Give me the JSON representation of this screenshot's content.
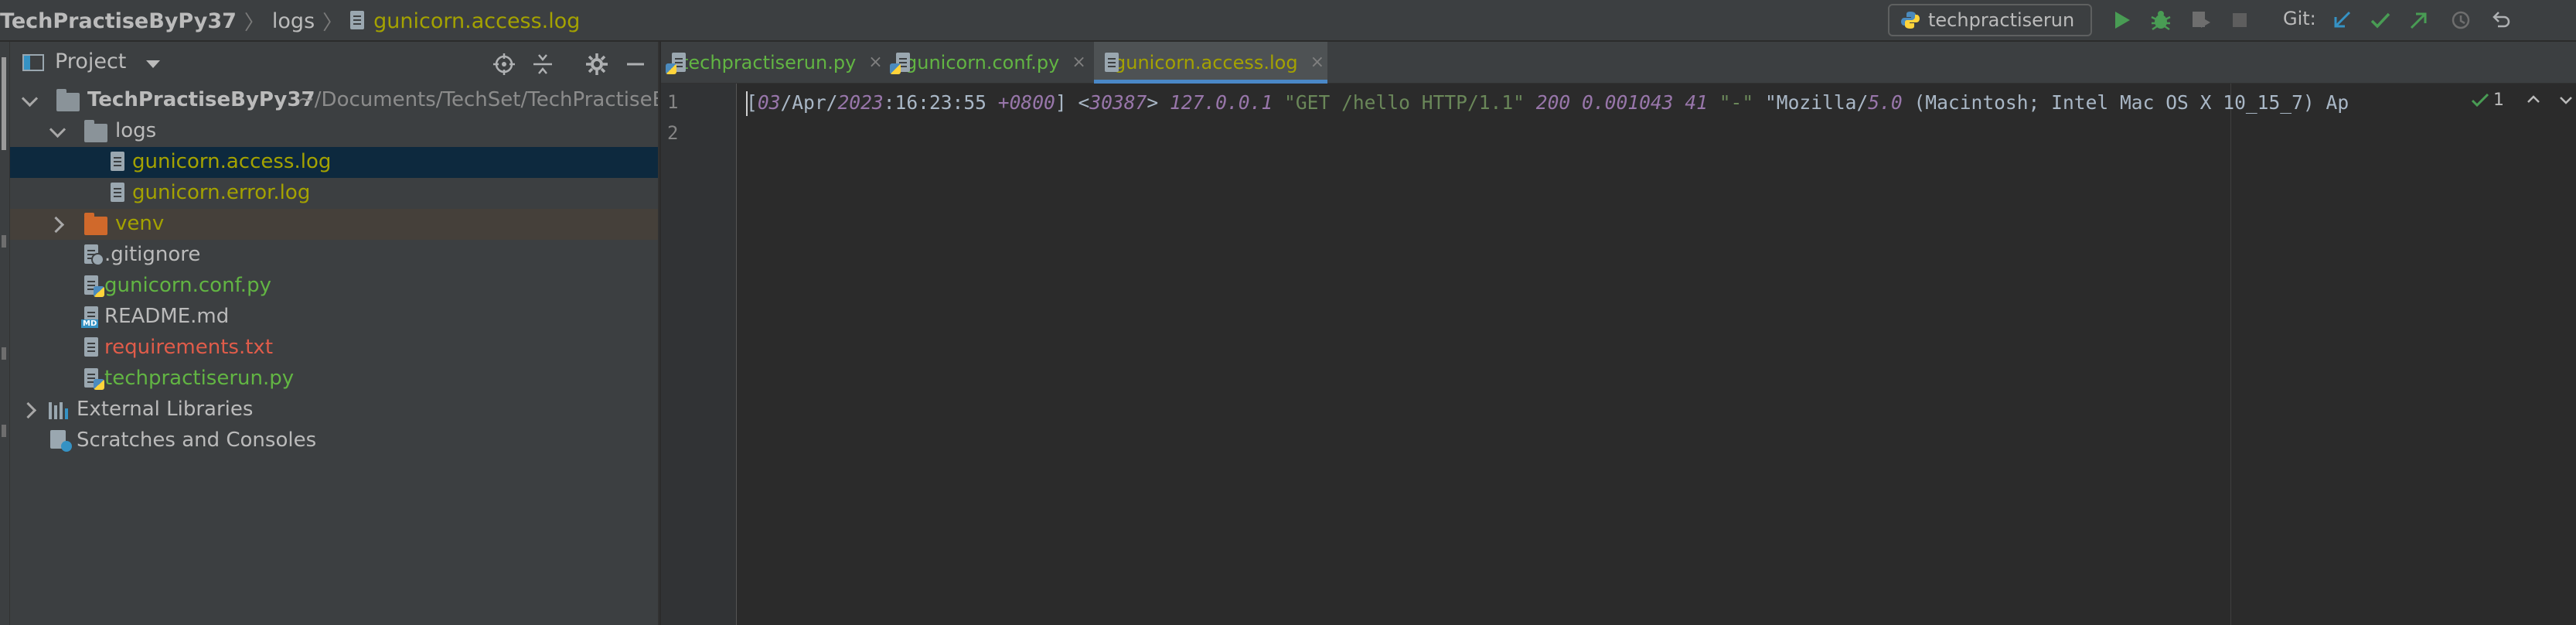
{
  "breadcrumb": {
    "project": "TechPractiseByPy37",
    "folder": "logs",
    "file": "gunicorn.access.log"
  },
  "toolbar": {
    "run_config": "techpractiserun",
    "git_label": "Git:",
    "icons": [
      "run-icon",
      "debug-icon",
      "coverage-icon",
      "stop-icon",
      "git-update-icon",
      "git-commit-icon",
      "git-push-icon",
      "history-icon",
      "rollback-icon"
    ]
  },
  "project_panel": {
    "title": "Project",
    "tree": [
      {
        "name": "TechPractiseByPy37",
        "path": "~/Documents/TechSet/TechPractiseBy",
        "icon": "folder-icon"
      },
      {
        "name": "logs",
        "icon": "folder-icon"
      },
      {
        "name": "gunicorn.access.log",
        "icon": "log-file-icon",
        "color": "#a4a200"
      },
      {
        "name": "gunicorn.error.log",
        "icon": "log-file-icon",
        "color": "#a4a200"
      },
      {
        "name": "venv",
        "icon": "folder-icon",
        "color": "#a4a200"
      },
      {
        "name": ".gitignore",
        "icon": "gitignore-file-icon"
      },
      {
        "name": "gunicorn.conf.py",
        "icon": "python-file-icon",
        "color": "#62b543"
      },
      {
        "name": "README.md",
        "icon": "markdown-file-icon"
      },
      {
        "name": "requirements.txt",
        "icon": "text-file-icon",
        "color": "#e05c4a"
      },
      {
        "name": "techpractiserun.py",
        "icon": "python-file-icon",
        "color": "#62b543"
      },
      {
        "name": "External Libraries",
        "icon": "libraries-icon"
      },
      {
        "name": "Scratches and Consoles",
        "icon": "scratches-icon"
      }
    ]
  },
  "tabs": [
    {
      "label": "techpractiserun.py",
      "close": "×"
    },
    {
      "label": "gunicorn.conf.py",
      "close": "×"
    },
    {
      "label": "gunicorn.access.log",
      "close": "×"
    }
  ],
  "editor": {
    "line_numbers": [
      "1",
      "2"
    ],
    "line1": {
      "open_bracket": "[",
      "day": "03",
      "month_sep": "/Apr/",
      "year": "2023",
      "time": ":16:23:55 ",
      "tz": "+0800",
      "close_bracket": "] ",
      "lt": "<",
      "pid": "30387",
      "gt": "> ",
      "ip": "127.0.0.1",
      "sp1": " ",
      "request": "\"GET /hello HTTP/1.1\"",
      "sp2": " ",
      "status": "200",
      "sp3": " ",
      "duration": "0.001043",
      "sp4": " ",
      "size": "41",
      "sp5": " ",
      "referer": "\"-\"",
      "sp6": " ",
      "ua_quote": "\"Mozilla/",
      "ua_ver": "5.0",
      "ua_rest": " (Macintosh; Intel Mac OS X 10_15_7) Ap"
    },
    "inspection_count": "1"
  },
  "colors": {
    "accent": "#4a88c7",
    "selected_row": "#0d293e",
    "excluded_row": "#45403a",
    "modified_green": "#62b543",
    "unversioned_olive": "#a4a200",
    "error_red": "#e05c4a"
  }
}
